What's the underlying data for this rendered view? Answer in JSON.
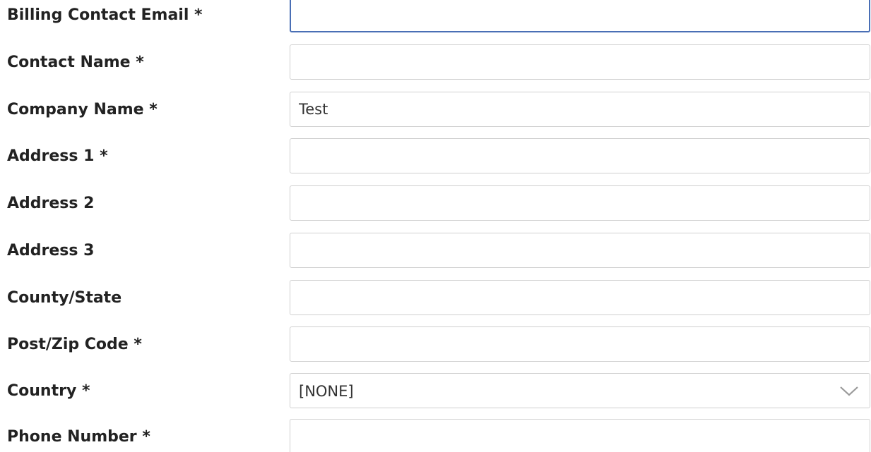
{
  "form": {
    "fields": [
      {
        "label": "Billing Contact Email *",
        "value": ""
      },
      {
        "label": "Contact Name *",
        "value": ""
      },
      {
        "label": "Company Name *",
        "value": "Test"
      },
      {
        "label": "Address 1 *",
        "value": ""
      },
      {
        "label": "Address 2",
        "value": ""
      },
      {
        "label": "Address 3",
        "value": ""
      },
      {
        "label": "County/State",
        "value": ""
      },
      {
        "label": "Post/Zip Code *",
        "value": ""
      },
      {
        "label": "Country *",
        "value": "[NONE]"
      },
      {
        "label": "Phone Number *",
        "value": ""
      }
    ]
  },
  "colors": {
    "focus_border": "#4a6fb5",
    "field_border": "#cfcfcf",
    "label_text": "#222222"
  },
  "icons": {
    "country_dropdown": "chevron-down-icon"
  }
}
